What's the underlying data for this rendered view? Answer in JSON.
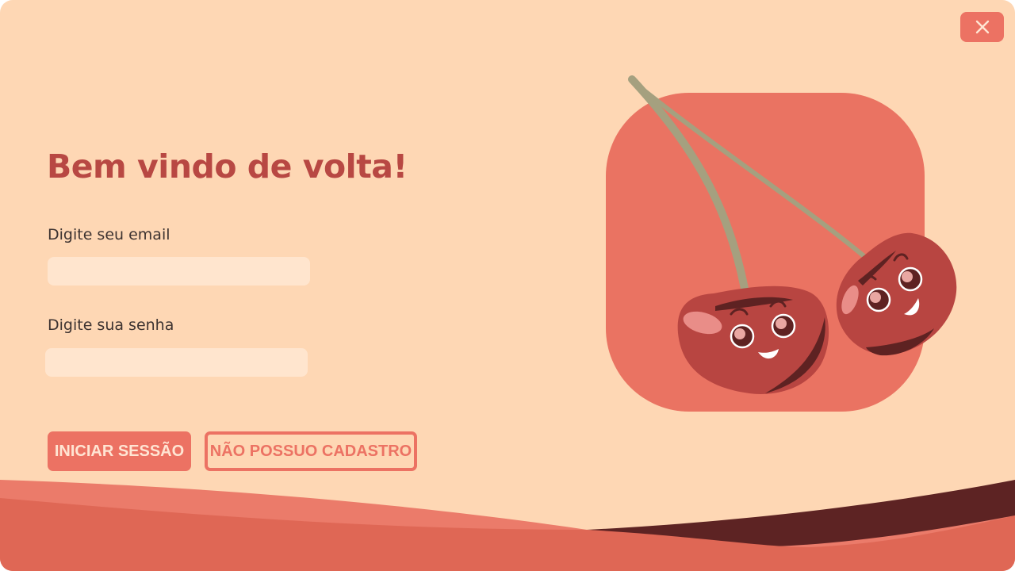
{
  "window": {
    "close_icon": "close-icon"
  },
  "login": {
    "title": "Bem vindo de volta!",
    "email_label": "Digite seu email",
    "email_value": "",
    "email_placeholder": "",
    "password_label": "Digite sua senha",
    "password_value": "",
    "password_placeholder": "",
    "login_button": "INICIAR SESSÃO",
    "register_button": "NÃO POSSUO CADASTRO"
  },
  "illustration": {
    "subject": "cherry-pair"
  },
  "colors": {
    "background": "#fed7b4",
    "accent": "#ec7263",
    "title": "#b84843",
    "input_bg": "#ffe5ce",
    "cherry": "#b84541",
    "cherry_dark": "#5e2222",
    "stem": "#a5a07f",
    "wave_dark": "#5d2323"
  }
}
